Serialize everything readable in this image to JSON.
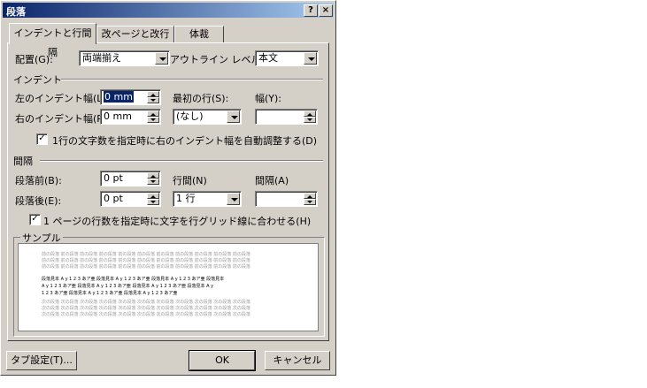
{
  "window": {
    "title": "段落",
    "help_btn": "?",
    "close_btn": "×"
  },
  "tabs": [
    {
      "label": "インデントと行間隔"
    },
    {
      "label": "改ページと改行"
    },
    {
      "label": "体裁"
    }
  ],
  "alignment": {
    "label": "配置(G):",
    "value": "両端揃え"
  },
  "outline": {
    "label": "アウトライン レベル(O):",
    "value": "本文"
  },
  "indent_section": {
    "title": "インデント"
  },
  "left_indent": {
    "label": "左のインデント幅(L):",
    "value": "0 mm"
  },
  "right_indent": {
    "label": "右のインデント幅(R):",
    "value": "0 mm"
  },
  "first_line": {
    "label": "最初の行(S):",
    "value": "(なし)"
  },
  "width": {
    "label": "幅(Y):",
    "value": ""
  },
  "auto_indent_check": {
    "label": "1行の文字数を指定時に右のインデント幅を自動調整する(D)",
    "checked": "✓"
  },
  "spacing_section": {
    "title": "間隔"
  },
  "before": {
    "label": "段落前(B):",
    "value": "0 pt"
  },
  "after": {
    "label": "段落後(E):",
    "value": "0 pt"
  },
  "line_spacing": {
    "label": "行間(N)",
    "value": "1 行"
  },
  "spacing_at": {
    "label": "間隔(A)",
    "value": ""
  },
  "grid_check": {
    "label": "1 ページの行数を指定時に文字を行グリッド線に合わせる(H)",
    "checked": "✓"
  },
  "sample": {
    "title": "サンプル",
    "prev_lines": [
      "前の段落 前の段落 前の段落 前の段落 前の段落 前の段落 前の段落 前の段落 前の段落 前の段落 前の段落",
      "前の段落 前の段落 前の段落 前の段落 前の段落 前の段落 前の段落 前の段落 前の段落 前の段落 前の段落",
      "前の段落 前の段落 前の段落 前の段落 前の段落 前の段落 前の段落 前の段落 前の段落 前の段落 前の段落"
    ],
    "cur_lines": [
      "段落見本 A y 1 2 3 あア亜 段落見本 A y 1 2 3 あア亜 段落見本 A y 1 2 3 あア亜 段落見本",
      "A y 1 2 3 あア亜 段落見本 A y 1 2 3 あア亜 段落見本 A y 1 2 3 あア亜 段落見本 A y",
      "1 2 3 あア亜 段落見本 A y 1 2 3 あア亜 段落見本 A y 1 2 3 あア亜"
    ],
    "next_lines": [
      "次の段落 次の段落 次の段落 次の段落 次の段落 次の段落 次の段落 次の段落 次の段落 次の段落 次の段落",
      "次の段落 次の段落 次の段落 次の段落 次の段落 次の段落 次の段落 次の段落 次の段落 次の段落 次の段落",
      "次の段落 次の段落 次の段落 次の段落 次の段落 次の段落 次の段落 次の段落 次の段落 次の段落 次の段落"
    ]
  },
  "buttons": {
    "tabs": "タブ設定(T)...",
    "ok": "OK",
    "cancel": "キャンセル"
  }
}
